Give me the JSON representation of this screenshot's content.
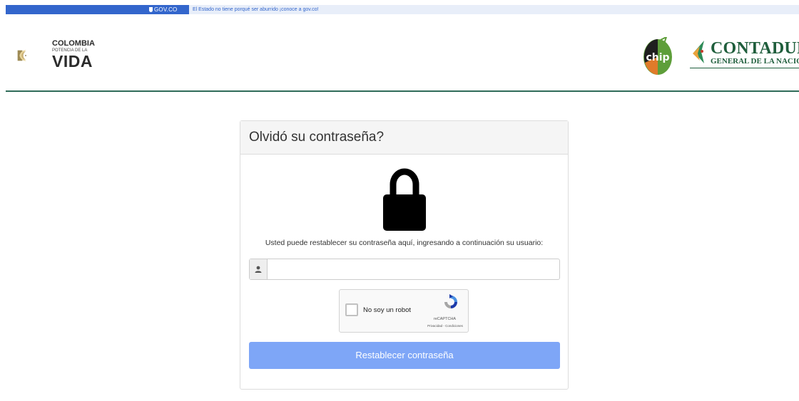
{
  "gov_bar": {
    "logo_text": "GOV.CO",
    "message": "El Estado no tiene porqué ser aburrido ¡conoce a gov.co!"
  },
  "header": {
    "colombia_line1": "COLOMBIA",
    "colombia_line2": "POTENCIA DE LA",
    "colombia_line3": "VIDA",
    "chip_text": "chip",
    "contaduria_title": "CONTADURÍA",
    "contaduria_subtitle": "GENERAL DE LA NACIÓN"
  },
  "panel": {
    "title": "Olvidó su contraseña?",
    "help_text": "Usted puede restablecer su contraseña aquí, ingresando a continuación su usuario:",
    "username_value": "",
    "username_placeholder": "",
    "recaptcha": {
      "label": "No soy un robot",
      "brand": "reCAPTCHA",
      "links": "Privacidad - Condiciones"
    },
    "submit_label": "Restablecer contraseña"
  },
  "colors": {
    "gov_blue": "#3366cc",
    "header_line": "#2e6b58",
    "button": "#7ea6f7",
    "contaduria_green": "#1f5e3c"
  }
}
